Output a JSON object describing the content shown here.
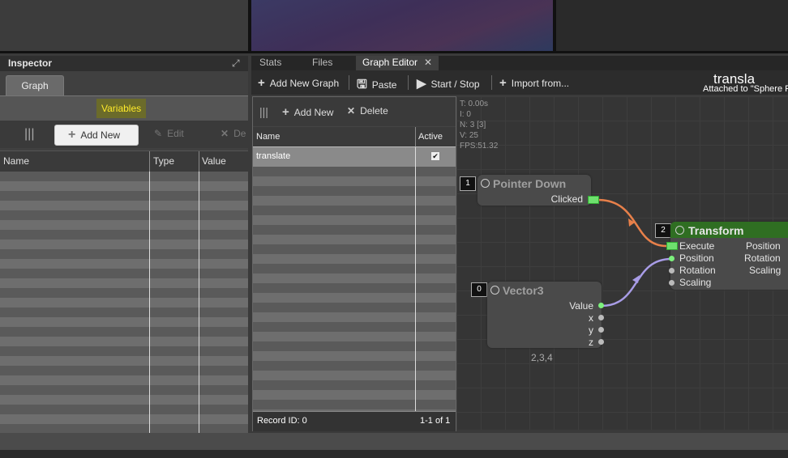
{
  "inspector": {
    "title": "Inspector",
    "graph_tab": "Graph",
    "variables_label": "Variables",
    "toolbar": {
      "add_new": "Add New",
      "edit": "Edit",
      "delete": "De"
    },
    "columns": [
      "Name",
      "Type",
      "Value"
    ]
  },
  "tabs": [
    {
      "label": "Stats"
    },
    {
      "label": "Files"
    },
    {
      "label": "Graph Editor",
      "active": true
    }
  ],
  "toolbar": {
    "add_new_graph": "Add New Graph",
    "paste": "Paste",
    "start_stop": "Start / Stop",
    "import_from": "Import from..."
  },
  "header": {
    "title": "transla",
    "subtitle": "Attached to \"Sphere P"
  },
  "graph_list": {
    "add_new": "Add New",
    "delete": "Delete",
    "columns": [
      "Name",
      "Active"
    ],
    "rows": [
      {
        "name": "translate",
        "active": true
      }
    ],
    "record_id": "Record ID: 0",
    "count": "1-1 of 1"
  },
  "stats": {
    "t": "T: 0.00s",
    "i": "I: 0",
    "n": "N: 3 [3]",
    "v": "V: 25",
    "fps": "FPS:51.32"
  },
  "nodes": {
    "pointer_down": {
      "index": "1",
      "title": "Pointer Down",
      "output": "Clicked"
    },
    "transform": {
      "index": "2",
      "title": "Transform",
      "inputs": [
        "Execute",
        "Position",
        "Rotation",
        "Scaling"
      ],
      "outputs": [
        "Position",
        "Rotation",
        "Scaling"
      ]
    },
    "vector3": {
      "index": "0",
      "title": "Vector3",
      "outputs": [
        "Value",
        "x",
        "y",
        "z"
      ],
      "value": "2,3,4"
    }
  },
  "colors": {
    "accent_yellow": "#ffeb2a",
    "transform_header": "#2f6e22",
    "exec_link": "#e8804a",
    "data_link": "#a89ce6"
  }
}
